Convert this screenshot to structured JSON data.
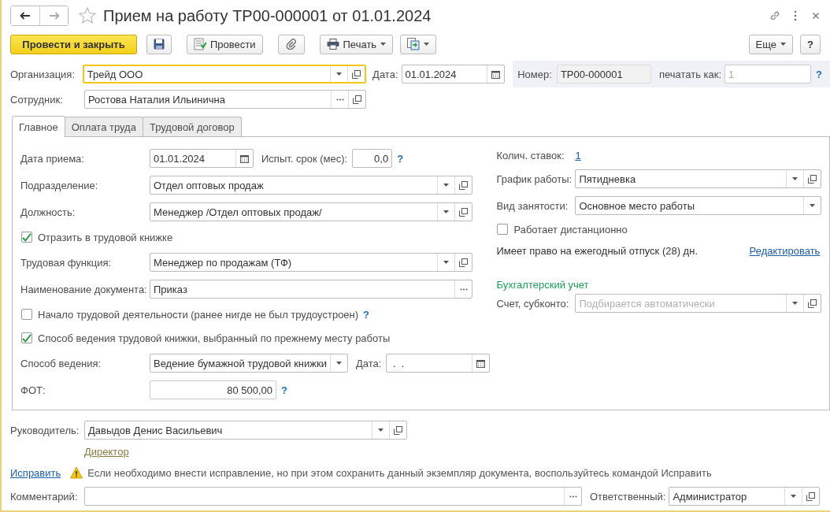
{
  "window": {
    "title": "Прием на работу ТР00-000001 от 01.01.2024",
    "favorite": false
  },
  "toolbar": {
    "post_and_close": "Провести и закрыть",
    "post": "Провести",
    "print": "Печать",
    "more": "Еще",
    "help": "?"
  },
  "header": {
    "organization": {
      "label": "Организация:",
      "value": "Трейд ООО",
      "focused": true
    },
    "date": {
      "label": "Дата:",
      "value": "01.01.2024"
    },
    "number": {
      "label": "Номер:",
      "value": "ТР00-000001"
    },
    "print_as": {
      "label": "печатать как:",
      "value": "1",
      "disabled": true
    },
    "help": "?",
    "employee": {
      "label": "Сотрудник:",
      "value": "Ростова Наталия Ильинична"
    }
  },
  "tabs": [
    {
      "label": "Главное",
      "selected": true
    },
    {
      "label": "Оплата труда",
      "selected": false
    },
    {
      "label": "Трудовой договор",
      "selected": false
    }
  ],
  "main": {
    "hire_date": {
      "label": "Дата приема:",
      "value": "01.01.2024"
    },
    "trial": {
      "label": "Испыт. срок (мес):",
      "value": "0,0",
      "help": "?"
    },
    "department": {
      "label": "Подразделение:",
      "value": "Отдел оптовых продаж"
    },
    "position": {
      "label": "Должность:",
      "value": "Менеджер /Отдел оптовых продаж/"
    },
    "reflect_in_book": {
      "label": "Отразить в трудовой книжке",
      "checked": true
    },
    "labor_function": {
      "label": "Трудовая функция:",
      "value": "Менеджер по продажам (ТФ)"
    },
    "document_name": {
      "label": "Наименование документа:",
      "value": "Приказ"
    },
    "first_job": {
      "label": "Начало трудовой деятельности (ранее нигде не был трудоустроен)",
      "checked": false,
      "help": "?"
    },
    "previous_method": {
      "label": "Способ ведения трудовой книжки, выбранный по прежнему месту работы",
      "checked": true
    },
    "method": {
      "label": "Способ ведения:",
      "value": "Ведение бумажной трудовой книжки"
    },
    "method_date": {
      "label": "Дата:",
      "value": " .  ."
    },
    "payroll": {
      "label": "ФОТ:",
      "value": "80 500,00",
      "help": "?"
    },
    "rates": {
      "label": "Колич. ставок:",
      "value": "1"
    },
    "schedule": {
      "label": "График работы:",
      "value": "Пятидневка"
    },
    "employment": {
      "label": "Вид занятости:",
      "value": "Основное место работы"
    },
    "remote": {
      "label": "Работает дистанционно",
      "checked": false
    },
    "vacation": {
      "text": "Имеет право на ежегодный отпуск (28) дн.",
      "link": "Редактировать"
    },
    "accounting_title": "Бухгалтерский учет",
    "account": {
      "label": "Счет, субконто:",
      "placeholder": "Подбирается автоматически"
    }
  },
  "footer": {
    "manager": {
      "label": "Руководитель:",
      "value": "Давыдов Денис Васильевич"
    },
    "manager_position": "Директор",
    "fix_link": "Исправить",
    "fix_warning": "Если необходимо внести исправление, но при этом сохранить данный экземпляр документа, воспользуйтесь командой Исправить",
    "comment": {
      "label": "Комментарий:"
    },
    "responsible": {
      "label": "Ответственный:",
      "value": "Администратор"
    }
  }
}
